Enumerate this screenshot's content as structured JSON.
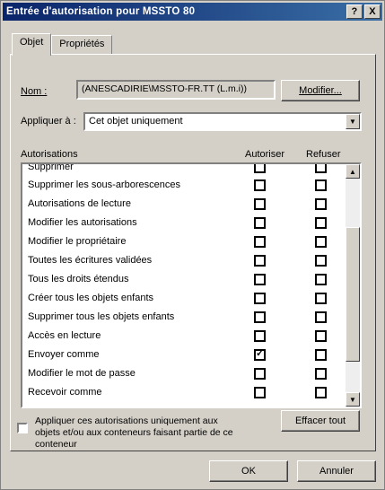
{
  "window": {
    "title": "Entrée d'autorisation pour MSSTO 80",
    "buttons": [
      "?",
      "X"
    ]
  },
  "tabs": [
    {
      "label": "Objet",
      "active": true
    },
    {
      "label": "Propriétés",
      "active": false
    }
  ],
  "name": {
    "label": "Nom :",
    "value": "(ANESCADIRIE\\MSSTO-FR.TT (L.m.i))",
    "modify_button": "Modifier..."
  },
  "apply": {
    "label": "Appliquer à :",
    "value": "Cet objet uniquement"
  },
  "permissions": {
    "header_name": "Autorisations",
    "header_allow": "Autoriser",
    "header_deny": "Refuser",
    "items": [
      {
        "label": "Supprimer",
        "allow": false,
        "deny": false
      },
      {
        "label": "Supprimer les sous-arborescences",
        "allow": false,
        "deny": false
      },
      {
        "label": "Autorisations de lecture",
        "allow": false,
        "deny": false
      },
      {
        "label": "Modifier les autorisations",
        "allow": false,
        "deny": false
      },
      {
        "label": "Modifier le propriétaire",
        "allow": false,
        "deny": false
      },
      {
        "label": "Toutes les écritures validées",
        "allow": false,
        "deny": false
      },
      {
        "label": "Tous les droits étendus",
        "allow": false,
        "deny": false
      },
      {
        "label": "Créer tous les objets enfants",
        "allow": false,
        "deny": false
      },
      {
        "label": "Supprimer tous les objets enfants",
        "allow": false,
        "deny": false
      },
      {
        "label": "Accès en lecture",
        "allow": false,
        "deny": false
      },
      {
        "label": "Envoyer comme",
        "allow": true,
        "deny": false
      },
      {
        "label": "Modifier le mot de passe",
        "allow": false,
        "deny": false
      },
      {
        "label": "Recevoir comme",
        "allow": false,
        "deny": false
      }
    ]
  },
  "inherit": {
    "text": "Appliquer ces autorisations uniquement aux objets et/ou aux conteneurs faisant partie de ce conteneur",
    "clear_button": "Effacer tout"
  },
  "footer": {
    "ok": "OK",
    "cancel": "Annuler"
  }
}
